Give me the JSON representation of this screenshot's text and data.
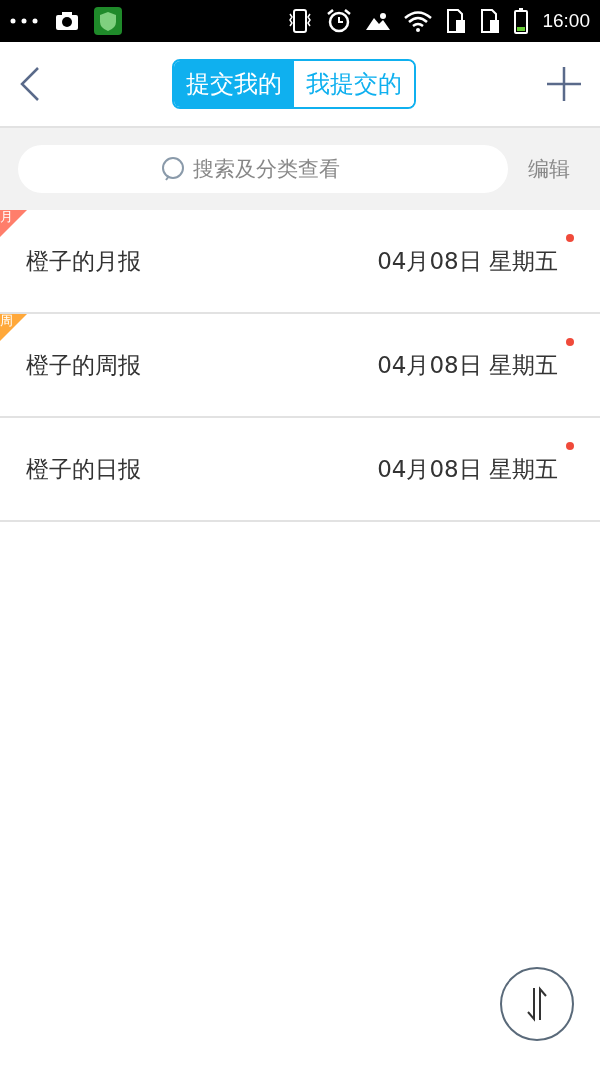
{
  "status_bar": {
    "time": "16:00"
  },
  "header": {
    "tabs": [
      {
        "label": "提交我的",
        "selected": true
      },
      {
        "label": "我提交的",
        "selected": false
      }
    ]
  },
  "search": {
    "placeholder": "搜索及分类查看",
    "edit_label": "编辑"
  },
  "reports": [
    {
      "title": "橙子的月报",
      "date": "04月08日 星期五",
      "unread": true,
      "tag": {
        "label": "月",
        "color": "#ff7e6b"
      }
    },
    {
      "title": "橙子的周报",
      "date": "04月08日 星期五",
      "unread": true,
      "tag": {
        "label": "周",
        "color": "#ffa83a"
      }
    },
    {
      "title": "橙子的日报",
      "date": "04月08日 星期五",
      "unread": true
    }
  ]
}
